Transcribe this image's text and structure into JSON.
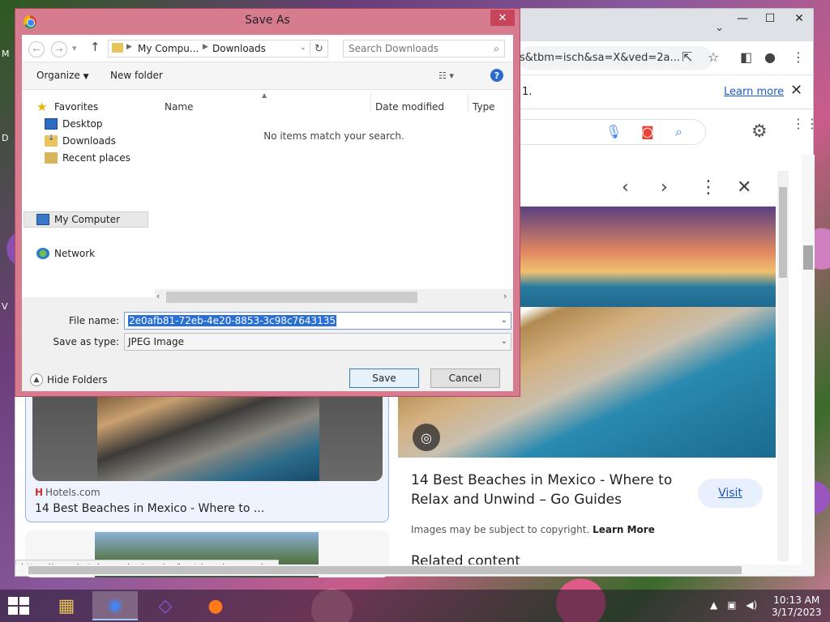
{
  "browser": {
    "omnibox_text": "s&tbm=isch&sa=X&ved=2a...",
    "info_text": "1.",
    "learn_more": "Learn more",
    "status_url": "https://www.hotels.com/go/mexico/best-beaches-mexico"
  },
  "results": {
    "left": {
      "source": "Hotels.com",
      "title": "14 Best Beaches in Mexico - Where to ..."
    },
    "preview": {
      "title": "14 Best Beaches in Mexico - Where to Relax and Unwind – Go Guides",
      "visit_label": "Visit",
      "copyright_text": "Images may be subject to copyright.",
      "copyright_link": "Learn More",
      "related_heading": "Related content"
    }
  },
  "dialog": {
    "title": "Save As",
    "breadcrumb": [
      "My Compu...",
      "Downloads"
    ],
    "search_placeholder": "Search Downloads",
    "toolbar": {
      "organize": "Organize",
      "new_folder": "New folder"
    },
    "tree": {
      "favorites": "Favorites",
      "desktop": "Desktop",
      "downloads": "Downloads",
      "recent": "Recent places",
      "my_computer": "My Computer",
      "network": "Network"
    },
    "columns": {
      "name": "Name",
      "date_modified": "Date modified",
      "type": "Type"
    },
    "empty_message": "No items match your search.",
    "file_name_label": "File name:",
    "file_name_value": "2e0afb81-72eb-4e20-8853-3c98c7643135",
    "save_type_label": "Save as type:",
    "save_type_value": "JPEG Image",
    "hide_folders": "Hide Folders",
    "save_button": "Save",
    "cancel_button": "Cancel"
  },
  "taskbar": {
    "time": "10:13 AM",
    "date": "3/17/2023"
  }
}
